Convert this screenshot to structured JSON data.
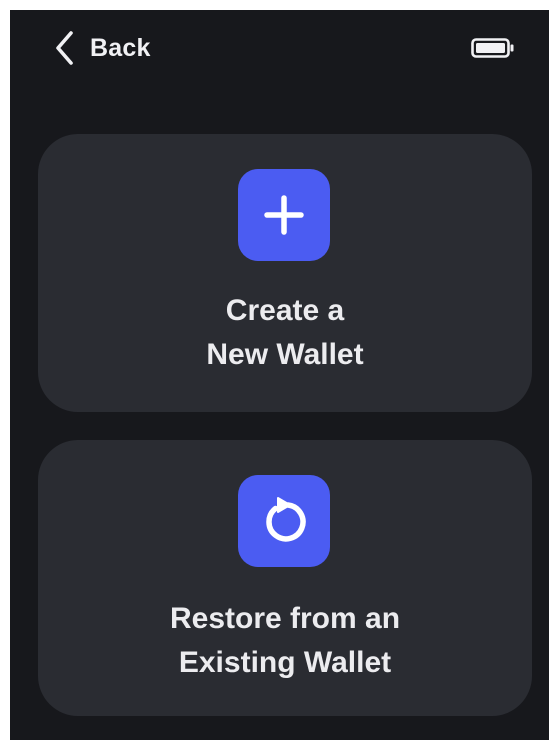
{
  "header": {
    "back_label": "Back",
    "back_icon": "chevron-left-icon",
    "battery_icon": "battery-icon"
  },
  "options": [
    {
      "icon": "plus-icon",
      "title_line1": "Create a",
      "title_line2": "New Wallet"
    },
    {
      "icon": "restore-icon",
      "title_line1": "Restore from an",
      "title_line2": "Existing Wallet"
    }
  ],
  "colors": {
    "background": "#17181c",
    "card": "#2a2c32",
    "accent": "#4b5cf2",
    "text": "#ececef"
  }
}
